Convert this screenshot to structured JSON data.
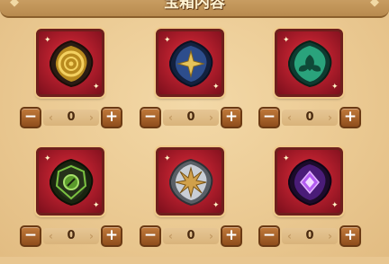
{
  "title": "宝箱内容",
  "items": [
    {
      "icon": "gold-rune-gem-icon",
      "quantity": "0",
      "minus": "−",
      "plus": "+"
    },
    {
      "icon": "blue-star-gem-icon",
      "quantity": "0",
      "minus": "−",
      "plus": "+"
    },
    {
      "icon": "green-leaf-gem-icon",
      "quantity": "0",
      "minus": "−",
      "plus": "+"
    },
    {
      "icon": "dark-green-gem-icon",
      "quantity": "0",
      "minus": "−",
      "plus": "+"
    },
    {
      "icon": "silver-star-gem-icon",
      "quantity": "0",
      "minus": "−",
      "plus": "+"
    },
    {
      "icon": "purple-void-gem-icon",
      "quantity": "0",
      "minus": "−",
      "plus": "+"
    }
  ],
  "colors": {
    "panel": "#ebca93",
    "tile": "#b51f2d",
    "button": "#a8622a"
  }
}
